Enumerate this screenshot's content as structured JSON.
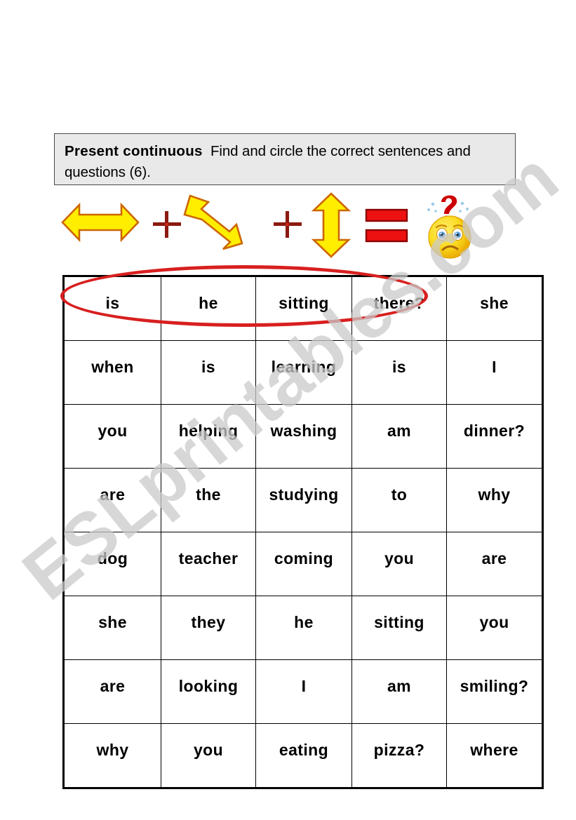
{
  "header": {
    "lead": "Present continuous",
    "instruction": "Find and circle the correct sentences and questions (6)."
  },
  "equation": {
    "items": [
      {
        "kind": "arrow-horizontal",
        "name": "double-arrow-horizontal-icon"
      },
      {
        "kind": "plus",
        "name": "plus-sign-icon"
      },
      {
        "kind": "arrow-diagonal",
        "name": "double-arrow-diagonal-icon"
      },
      {
        "kind": "plus",
        "name": "plus-sign-icon"
      },
      {
        "kind": "arrow-vertical",
        "name": "double-arrow-vertical-icon"
      },
      {
        "kind": "equals",
        "name": "equals-sign-icon"
      },
      {
        "kind": "emoji",
        "name": "confused-face-icon"
      }
    ],
    "arrow_fill": "#ffee00",
    "arrow_stroke": "#cc6600",
    "plus_color": "#8c1a10",
    "equals_fill": "#ee1111",
    "equals_stroke": "#8c0000",
    "emoji_face": "#fada1e",
    "emoji_shadow": "#e8a500",
    "emoji_question": "#cc0000",
    "emoji_eye": "#5a9bd4"
  },
  "grid": {
    "columns": 5,
    "rows": [
      [
        "is",
        "he",
        "sitting",
        "there?",
        "she"
      ],
      [
        "when",
        "is",
        "learning",
        "is",
        "I"
      ],
      [
        "you",
        "helping",
        "washing",
        "am",
        "dinner?"
      ],
      [
        "are",
        "the",
        "studying",
        "to",
        "why"
      ],
      [
        "dog",
        "teacher",
        "coming",
        "you",
        "are"
      ],
      [
        "she",
        "they",
        "he",
        "sitting",
        "you"
      ],
      [
        "are",
        "looking",
        "I",
        "am",
        "smiling?"
      ],
      [
        "why",
        "you",
        "eating",
        "pizza?",
        "where"
      ]
    ]
  },
  "annotation": {
    "circled_answer": [
      "is",
      "he",
      "sitting",
      "there?"
    ],
    "circle_color": "#d81f1f"
  },
  "watermark": {
    "text": "ESLprintables.com",
    "color": "#c9c9c9"
  }
}
